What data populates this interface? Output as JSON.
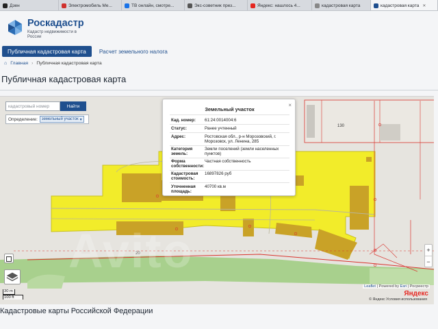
{
  "browser": {
    "tabs": [
      {
        "label": "Дзен",
        "color": "#222222",
        "active": false
      },
      {
        "label": "Электромобиль Ме...",
        "color": "#d0312d",
        "active": false
      },
      {
        "label": "ТВ онлайн, смотре...",
        "color": "#1a73e8",
        "active": false
      },
      {
        "label": "Экс-советник през...",
        "color": "#555555",
        "active": false
      },
      {
        "label": "Яндекс: нашлось 4...",
        "color": "#e52620",
        "active": false
      },
      {
        "label": "кадастровая карта",
        "color": "#888888",
        "active": false
      },
      {
        "label": "кадастровая карта",
        "color": "#1e4f8f",
        "active": true
      }
    ]
  },
  "header": {
    "title": "Роскадастр",
    "subtitle": "Кадастр недвижимости в России"
  },
  "nav": {
    "items": [
      {
        "label": "Публичная кадастровая карта",
        "active": true
      },
      {
        "label": "Расчет земельного налога",
        "active": false
      }
    ]
  },
  "breadcrumb": {
    "home": "Главная",
    "current": "Публичная кадастровая карта"
  },
  "page_title": "Публичная кадастровая карта",
  "map": {
    "search": {
      "placeholder": "кадастровый номер",
      "button": "Найти"
    },
    "define": {
      "label": "Определение:",
      "value": "земельный участок"
    },
    "popup": {
      "title": "Земельный участок",
      "rows": [
        {
          "label": "Кад. номер:",
          "value": "61:24:0014004:6"
        },
        {
          "label": "Статус:",
          "value": "Ранее учтенный"
        },
        {
          "label": "Адрес:",
          "value": "Ростовская обл., р-н Морозовский, г. Морозовск, ул. Ленина, 285"
        },
        {
          "label": "Категория земель:",
          "value": "Земли поселений (земли населенных пунктов)"
        },
        {
          "label": "Форма собственности:",
          "value": "Частная собственность"
        },
        {
          "label": "Кадастровая стоимость:",
          "value": "16897826 руб"
        },
        {
          "label": "Уточненная площадь:",
          "value": "40700 кв.м"
        }
      ]
    },
    "labels": {
      "parcel_130": "130",
      "road_20": "20"
    },
    "zoom": {
      "in": "+",
      "out": "−"
    },
    "scale": {
      "short": "30 m",
      "long": "100 ft"
    },
    "attribution": {
      "leaflet": "Leaflet",
      "sep1": "| Powered by",
      "esri": "Esri",
      "sep2": "| Росреестр"
    },
    "yandex": "Яндекс",
    "terms": "© Яндекс  Условия использования",
    "watermark": "Avito"
  },
  "footer_title": "Кадастровые карты Российской Федерации",
  "colors": {
    "brand": "#1e4f8f",
    "parcel_fill": "#f2ec2a",
    "building": "#c9a227",
    "green_strip": "#a8d08d",
    "boundary": "#d9332e"
  }
}
